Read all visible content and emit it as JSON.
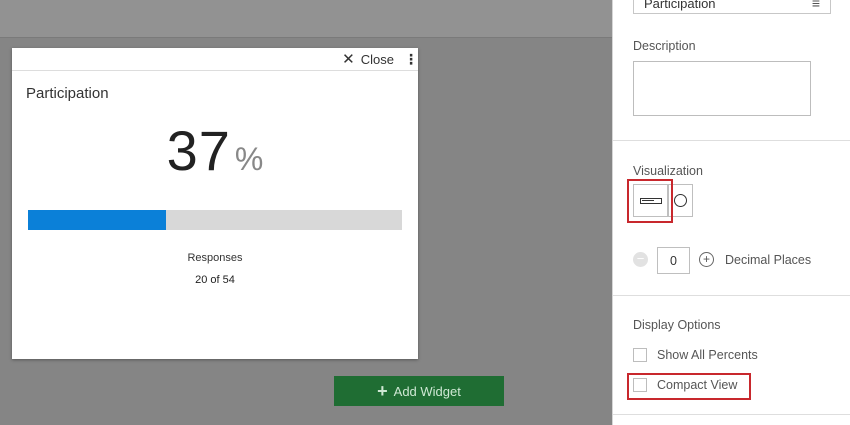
{
  "widget": {
    "close_label": "Close",
    "close_icon": "close-icon",
    "menu_icon": "kebab-menu-icon",
    "title": "Participation",
    "value": "37",
    "unit": "%",
    "progress_fraction": 0.37,
    "progress_color": "#0b80d8",
    "responses_label": "Responses",
    "responses_value": "20 of 54"
  },
  "canvas": {
    "add_widget_label": "Add Widget",
    "add_widget_color": "#1f6d33"
  },
  "panel": {
    "title_value": "Participation",
    "description_label": "Description",
    "description_value": "",
    "visualization_label": "Visualization",
    "visualization_options": [
      "bar",
      "gauge"
    ],
    "visualization_selected": "bar",
    "decimal_places_value": "0",
    "decimal_places_label": "Decimal Places",
    "display_options_label": "Display Options",
    "show_all_percents_label": "Show All Percents",
    "compact_view_label": "Compact View",
    "highlight_color": "#c8282d"
  }
}
